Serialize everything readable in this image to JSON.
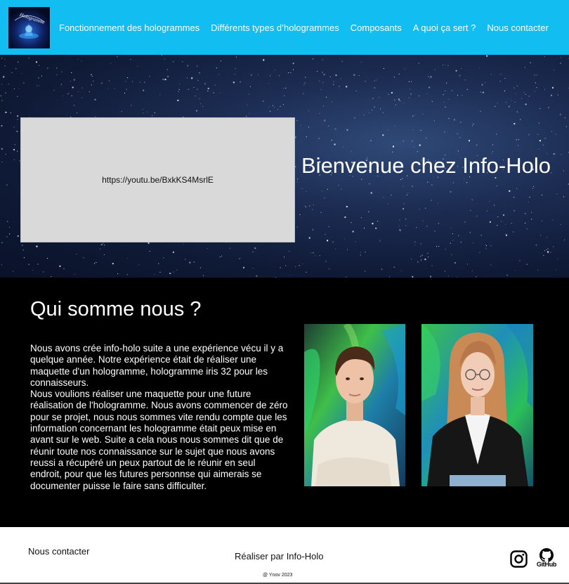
{
  "brand": {
    "logo_alt": "Hologramme",
    "logo_text": "Hologramme"
  },
  "nav": {
    "items": [
      {
        "label": "Fonctionnement des hologrammes"
      },
      {
        "label": "Différents types d’hologrammes"
      },
      {
        "label": "Composants"
      },
      {
        "label": "A quoi ça sert ?"
      },
      {
        "label": "Nous contacter"
      }
    ]
  },
  "hero": {
    "video_link": "https://youtu.be/BxkKS4MsrlE",
    "title": "Bienvenue chez Info-Holo"
  },
  "about": {
    "heading": "Qui somme nous ?",
    "paragraph": "Nous avons crée info-holo suite a une expérience vécu il y a quelque année. Notre expérience était de réaliser une maquette d'un hologramme, hologramme iris 32 pour les connaisseurs.\nNous voulions réaliser une maquette pour une future réalisation de l'hologramme. Nous avons commencer de zéro pour se projet, nous nous sommes vite rendu compte que les information concernant les hologramme était peux mise en avant sur le web. Suite a cela nous nous sommes dit que de réunir toute nos connaissance sur le sujet que nous avons reussi a récupéré un peux partout de le réunir en seul endroit, pour que les futures personnse qui aimerais se documenter puisse le faire sans difficulter."
  },
  "footer": {
    "contact": "Nous contacter",
    "credit": "Réaliser par Info-Holo",
    "copyright": "@ Ynov 2023",
    "github_label": "GitHub"
  },
  "colors": {
    "header_bg": "#12bdf2",
    "about_bg": "#000000",
    "hero_bg": "#1c2c52"
  },
  "icons": [
    "instagram-icon",
    "github-icon"
  ]
}
